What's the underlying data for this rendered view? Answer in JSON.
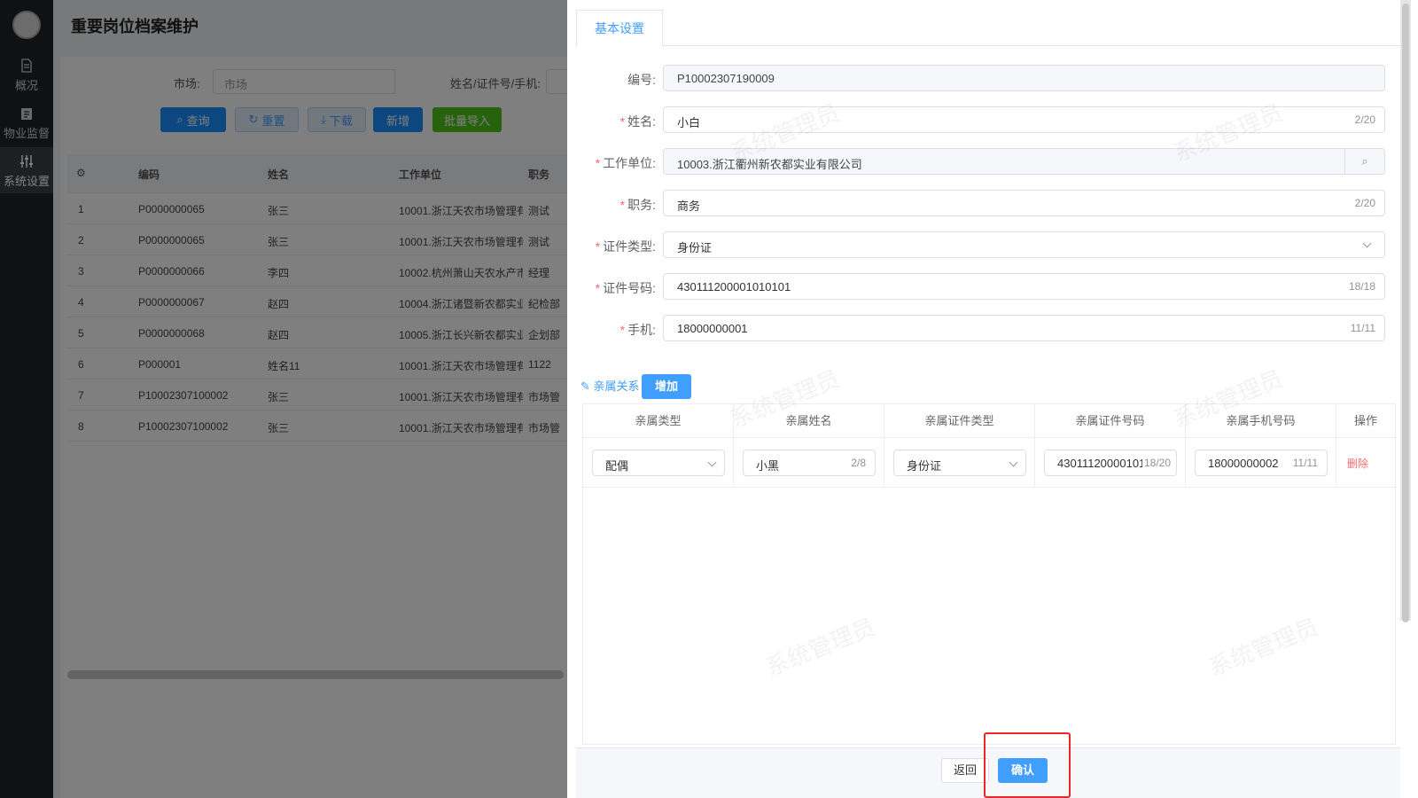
{
  "sidebar": {
    "items": [
      {
        "label": "概况",
        "icon": "document-icon"
      },
      {
        "label": "物业监督",
        "icon": "clipboard-icon"
      },
      {
        "label": "系统设置",
        "icon": "sliders-icon"
      }
    ]
  },
  "page_title": "重要岗位档案维护",
  "search": {
    "market_label": "市场:",
    "market_placeholder": "市场",
    "name_label": "姓名/证件号/手机:"
  },
  "toolbar": {
    "query": "查询",
    "reset": "重置",
    "download": "下载",
    "add": "新增",
    "import": "批量导入"
  },
  "grid": {
    "headers": [
      "编码",
      "姓名",
      "工作单位",
      "职务"
    ],
    "rows": [
      {
        "no": "1",
        "code": "P0000000065",
        "name": "张三",
        "unit": "10001.浙江天农市场管理有",
        "job": "测试"
      },
      {
        "no": "2",
        "code": "P0000000065",
        "name": "张三",
        "unit": "10001.浙江天农市场管理有",
        "job": "测试"
      },
      {
        "no": "3",
        "code": "P0000000066",
        "name": "李四",
        "unit": "10002.杭州萧山天农水产市",
        "job": "经理"
      },
      {
        "no": "4",
        "code": "P0000000067",
        "name": "赵四",
        "unit": "10004.浙江诸暨新农都实业",
        "job": "纪检部"
      },
      {
        "no": "5",
        "code": "P0000000068",
        "name": "赵四",
        "unit": "10005.浙江长兴新农都实业",
        "job": "企划部"
      },
      {
        "no": "6",
        "code": "P000001",
        "name": "姓名11",
        "unit": "10001.浙江天农市场管理有",
        "job": "1122"
      },
      {
        "no": "7",
        "code": "P10002307100002",
        "name": "张三",
        "unit": "10001.浙江天农市场管理有",
        "job": "市场管"
      },
      {
        "no": "8",
        "code": "P10002307100002",
        "name": "张三",
        "unit": "10001.浙江天农市场管理有",
        "job": "市场管"
      }
    ]
  },
  "drawer": {
    "tab": "基本设置",
    "fields": [
      {
        "label": "编号:",
        "value": "P10002307190009",
        "required": false,
        "disabled": true,
        "count": ""
      },
      {
        "label": "姓名:",
        "value": "小白",
        "required": true,
        "disabled": false,
        "count": "2/20"
      },
      {
        "label": "工作单位:",
        "value": "10003.浙江衢州新农都实业有限公司",
        "required": true,
        "disabled": true,
        "count": ""
      },
      {
        "label": "职务:",
        "value": "商务",
        "required": true,
        "disabled": false,
        "count": "2/20"
      },
      {
        "label": "证件类型:",
        "value": "身份证",
        "required": true,
        "disabled": false,
        "count": ""
      },
      {
        "label": "证件号码:",
        "value": "430111200001010101",
        "required": true,
        "disabled": false,
        "count": "18/18"
      },
      {
        "label": "手机:",
        "value": "18000000001",
        "required": true,
        "disabled": false,
        "count": "11/11"
      }
    ],
    "relatives_title": "亲属关系",
    "add_button": "增加",
    "table_headers": [
      "亲属类型",
      "亲属姓名",
      "亲属证件类型",
      "亲属证件号码",
      "亲属手机号码",
      "操作"
    ],
    "relative_row": {
      "type": "配偶",
      "name": "小黑",
      "name_count": "2/8",
      "id_type": "身份证",
      "id_number": "430111200001010",
      "id_count": "18/20",
      "phone": "18000000002",
      "phone_count": "11/11",
      "delete": "删除"
    },
    "back_button": "返回",
    "confirm_button": "确认"
  },
  "watermark": "系统管理员",
  "colors": {
    "primary": "#409eff",
    "danger": "#f56c6c",
    "highlight": "#e62828",
    "sidebar": "#1f2227"
  }
}
